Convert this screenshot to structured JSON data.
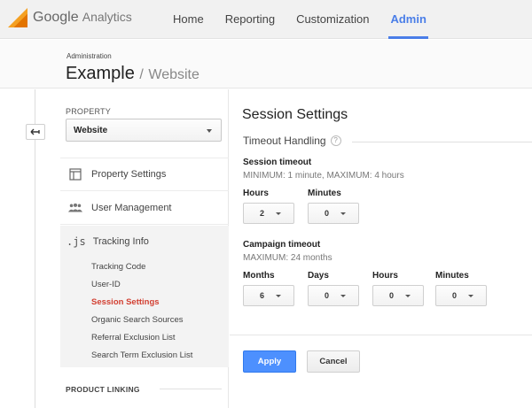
{
  "brand": {
    "google": "Google",
    "analytics": "Analytics"
  },
  "nav": {
    "items": [
      "Home",
      "Reporting",
      "Customization",
      "Admin"
    ],
    "active": "Admin",
    "accent": "#4a7ee8"
  },
  "header": {
    "breadcrumb": "Administration",
    "account": "Example",
    "separator": "/",
    "property": "Website"
  },
  "sidebar": {
    "property_label": "PROPERTY",
    "property_value": "Website",
    "items": [
      {
        "label": "Property Settings",
        "icon": "property-settings-icon"
      },
      {
        "label": "User Management",
        "icon": "users-icon"
      },
      {
        "label": "Tracking Info",
        "icon": "js-icon",
        "icon_text": ".js"
      }
    ],
    "tracking_sub": [
      "Tracking Code",
      "User-ID",
      "Session Settings",
      "Organic Search Sources",
      "Referral Exclusion List",
      "Search Term Exclusion List"
    ],
    "active_sub": "Session Settings",
    "product_linking": "PRODUCT LINKING"
  },
  "main": {
    "title": "Session Settings",
    "timeout_handling": "Timeout Handling",
    "help": "?",
    "session_timeout": {
      "heading": "Session timeout",
      "note": "MINIMUM: 1 minute, MAXIMUM: 4 hours",
      "hours_label": "Hours",
      "hours_value": "2",
      "minutes_label": "Minutes",
      "minutes_value": "0"
    },
    "campaign_timeout": {
      "heading": "Campaign timeout",
      "note": "MAXIMUM: 24 months",
      "months_label": "Months",
      "months_value": "6",
      "days_label": "Days",
      "days_value": "0",
      "hours_label": "Hours",
      "hours_value": "0",
      "minutes_label": "Minutes",
      "minutes_value": "0"
    },
    "apply": "Apply",
    "cancel": "Cancel"
  }
}
